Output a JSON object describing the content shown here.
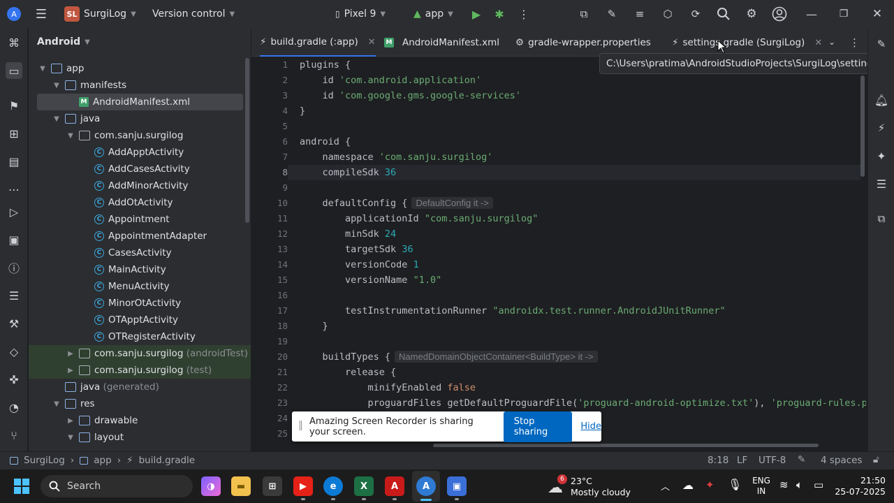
{
  "titlebar": {
    "project_initials": "SL",
    "project_name": "SurgiLog",
    "vcs_label": "Version control",
    "device": "Pixel 9",
    "run_config": "app"
  },
  "tree": {
    "view_mode": "Android",
    "rows": [
      {
        "label": "app",
        "suffix": ""
      },
      {
        "label": "manifests",
        "suffix": ""
      },
      {
        "label": "AndroidManifest.xml",
        "suffix": ""
      },
      {
        "label": "java",
        "suffix": ""
      },
      {
        "label": "com.sanju.surgilog",
        "suffix": ""
      },
      {
        "label": "AddApptActivity",
        "suffix": ""
      },
      {
        "label": "AddCasesActivity",
        "suffix": ""
      },
      {
        "label": "AddMinorActivity",
        "suffix": ""
      },
      {
        "label": "AddOtActivity",
        "suffix": ""
      },
      {
        "label": "Appointment",
        "suffix": ""
      },
      {
        "label": "AppointmentAdapter",
        "suffix": ""
      },
      {
        "label": "CasesActivity",
        "suffix": ""
      },
      {
        "label": "MainActivity",
        "suffix": ""
      },
      {
        "label": "MenuActivity",
        "suffix": ""
      },
      {
        "label": "MinorOtActivity",
        "suffix": ""
      },
      {
        "label": "OTApptActivity",
        "suffix": ""
      },
      {
        "label": "OTRegisterActivity",
        "suffix": ""
      },
      {
        "label": "com.sanju.surgilog",
        "suffix": "(androidTest)"
      },
      {
        "label": "com.sanju.surgilog",
        "suffix": "(test)"
      },
      {
        "label": "java",
        "suffix": "(generated)"
      },
      {
        "label": "res",
        "suffix": ""
      },
      {
        "label": "drawable",
        "suffix": ""
      },
      {
        "label": "layout",
        "suffix": ""
      }
    ]
  },
  "tabs": [
    {
      "label": "build.gradle (:app)"
    },
    {
      "label": "AndroidManifest.xml"
    },
    {
      "label": "gradle-wrapper.properties"
    },
    {
      "label": "settings.gradle (SurgiLog)"
    }
  ],
  "tooltip": "C:\\Users\\pratima\\AndroidStudioProjects\\SurgiLog\\settings.gradle",
  "editor": {
    "line_numbers": [
      "1",
      "2",
      "3",
      "4",
      "5",
      "6",
      "7",
      "8",
      "9",
      "10",
      "11",
      "12",
      "13",
      "14",
      "15",
      "16",
      "17",
      "18",
      "19",
      "20",
      "21",
      "22",
      "23",
      "24",
      "25"
    ],
    "current_line": "8",
    "code": {
      "l1": "plugins {",
      "l2a": "    id ",
      "l2b": "'com.android.application'",
      "l3a": "    id ",
      "l3b": "'com.google.gms.google-services'",
      "l4": "}",
      "l6": "android {",
      "l7a": "    namespace ",
      "l7b": "'com.sanju.surgilog'",
      "l8a": "    compileSdk ",
      "l8b": "36",
      "l10a": "    defaultConfig {",
      "l10hint": "DefaultConfig it ->",
      "l11a": "        applicationId ",
      "l11b": "\"com.sanju.surgilog\"",
      "l12a": "        minSdk ",
      "l12b": "24",
      "l13a": "        targetSdk ",
      "l13b": "36",
      "l14a": "        versionCode ",
      "l14b": "1",
      "l15a": "        versionName ",
      "l15b": "\"1.0\"",
      "l17a": "        testInstrumentationRunner ",
      "l17b": "\"androidx.test.runner.AndroidJUnitRunner\"",
      "l18": "    }",
      "l20a": "    buildTypes {",
      "l20hint": "NamedDomainObjectContainer<BuildType> it ->",
      "l21": "        release {",
      "l22a": "            minifyEnabled ",
      "l22b": "false",
      "l23a": "            proguardFiles getDefaultProguardFile(",
      "l23b": "'proguard-android-optimize.txt'",
      "l23c": "), ",
      "l23d": "'proguard-rules.pro'"
    }
  },
  "share_notice": {
    "text": "Amazing Screen Recorder is sharing your screen.",
    "stop_label": "Stop sharing",
    "hide_label": "Hide"
  },
  "statusbar": {
    "crumb_project": "SurgiLog",
    "crumb_module": "app",
    "crumb_file": "build.gradle",
    "caret_pos": "8:18",
    "line_sep": "LF",
    "encoding": "UTF-8",
    "indent": "4 spaces"
  },
  "taskbar": {
    "search_placeholder": "Search",
    "weather_badge": "6",
    "weather_temp": "23°C",
    "weather_desc": "Mostly cloudy",
    "lang_top": "ENG",
    "lang_bottom": "IN",
    "time": "21:50",
    "date": "25-07-2025"
  },
  "colors": {
    "accent": "#3574f0",
    "string": "#6aab73",
    "number": "#2aacb8",
    "keyword": "#cf8e6d",
    "share_button": "#0067c0"
  }
}
